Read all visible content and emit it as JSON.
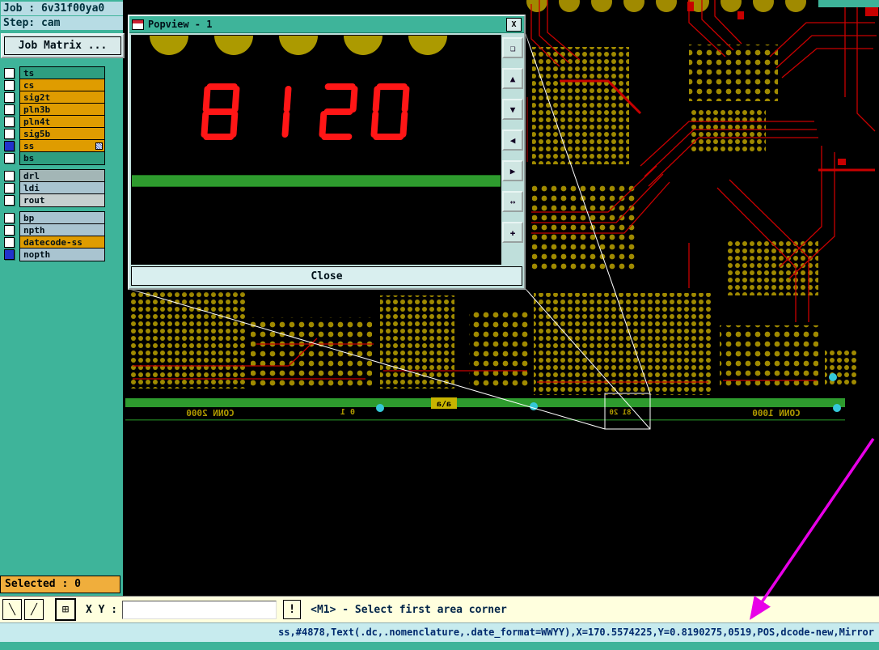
{
  "header": {
    "job": "Job : 6v31f00ya0",
    "step": "Step: cam",
    "job_matrix": "Job Matrix ..."
  },
  "layers": {
    "rows": [
      {
        "name": "ts",
        "color": "#2E9E80",
        "box": "#FFFFFF"
      },
      {
        "name": "cs",
        "color": "#DF9C00",
        "box": "#FFFFFF"
      },
      {
        "name": "sig2t",
        "color": "#DF9C00",
        "box": "#FFFFFF"
      },
      {
        "name": "pln3b",
        "color": "#DF9C00",
        "box": "#FFFFFF"
      },
      {
        "name": "pln4t",
        "color": "#DF9C00",
        "box": "#FFFFFF"
      },
      {
        "name": "sig5b",
        "color": "#DF9C00",
        "box": "#FFFFFF"
      },
      {
        "name": "ss",
        "color": "#DF9C00",
        "box": "#2233CC"
      },
      {
        "name": "bs",
        "color": "#2E9E80",
        "box": "#FFFFFF"
      },
      {
        "name": "drl",
        "color": "#A3B6B6",
        "box": "#FFFFFF"
      },
      {
        "name": "ldi",
        "color": "#A9C4D0",
        "box": "#FFFFFF"
      },
      {
        "name": "rout",
        "color": "#C6CFCF",
        "box": "#FFFFFF"
      },
      {
        "name": "bp",
        "color": "#A9C4D0",
        "box": "#FFFFFF"
      },
      {
        "name": "npth",
        "color": "#A9C4D0",
        "box": "#FFFFFF"
      },
      {
        "name": "datecode-ss",
        "color": "#DF9C00",
        "box": "#FFFFFF"
      },
      {
        "name": "nopth",
        "color": "#A9C4D0",
        "box": "#2233CC"
      }
    ]
  },
  "selected": "Selected : 0",
  "popview": {
    "title": "Popview - 1",
    "close_x": "X",
    "display_text": "81 20",
    "close_button": "Close",
    "toolbar": [
      {
        "name": "detach",
        "glyph": "❏"
      },
      {
        "name": "pan-up",
        "glyph": "▲"
      },
      {
        "name": "pan-down",
        "glyph": "▼"
      },
      {
        "name": "pan-left",
        "glyph": "◀"
      },
      {
        "name": "pan-right",
        "glyph": "▶"
      },
      {
        "name": "zoom-fit",
        "glyph": "↔"
      },
      {
        "name": "pan-free",
        "glyph": "✚"
      }
    ]
  },
  "board": {
    "silkscreen": {
      "left": "CONN 2000",
      "digits": "0 1",
      "logo": "a\\a",
      "datecode": "81 20",
      "right": "CONN 1000"
    }
  },
  "command_bar": {
    "tools": [
      {
        "name": "diagonal-select",
        "glyph": "╲"
      },
      {
        "name": "measure",
        "glyph": "╱"
      },
      {
        "name": "grid",
        "glyph": "⊞"
      }
    ],
    "xy_label": "X Y :",
    "xy_value": "",
    "alert": "!",
    "prompt": "<M1> - Select first area corner"
  },
  "status": "ss,#4878,Text(.dc,.nomenclature,.date_format=WWYY),X=170.5574225,Y=0.8190275,0519,POS,dcode-new,Mirror",
  "colors": {
    "sidebar_teal": "#3EB49A",
    "header_blue": "#B7DCE4",
    "selected_orange": "#F0AE3C",
    "command_yellow": "#FFFFDE",
    "status_cyan": "#C7EBEE",
    "trace_red": "#C80000",
    "pad_olive": "#A08A00",
    "board_green": "#2E9B2E",
    "display_red": "#FF1616",
    "annotation_magenta": "#E800E8"
  }
}
